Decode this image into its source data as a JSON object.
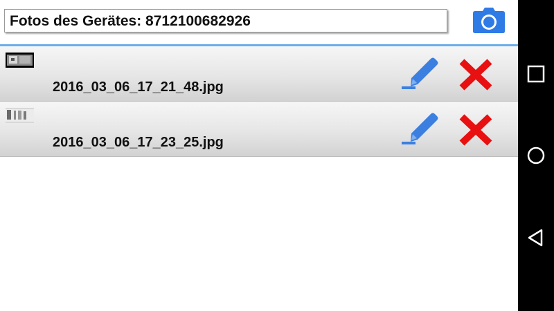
{
  "header": {
    "title": "Fotos des Gerätes: 8712100682926",
    "camera_icon": "camera-icon",
    "accent_color": "#2f7be6",
    "divider_color": "#6aaee8"
  },
  "photos": [
    {
      "filename": "2016_03_06_17_21_48.jpg",
      "thumbnail_icon": "photo-thumbnail",
      "edit_icon": "pencil-icon",
      "delete_icon": "red-x-icon"
    },
    {
      "filename": "2016_03_06_17_23_25.jpg",
      "thumbnail_icon": "photo-thumbnail",
      "edit_icon": "pencil-icon",
      "delete_icon": "red-x-icon"
    }
  ],
  "colors": {
    "edit": "#3b7fe0",
    "delete": "#e81010",
    "row_top": "#f6f6f6",
    "row_bottom": "#d2d2d2",
    "navbar": "#000000"
  },
  "navigation": {
    "buttons": [
      "recents-icon",
      "home-icon",
      "back-icon"
    ]
  }
}
